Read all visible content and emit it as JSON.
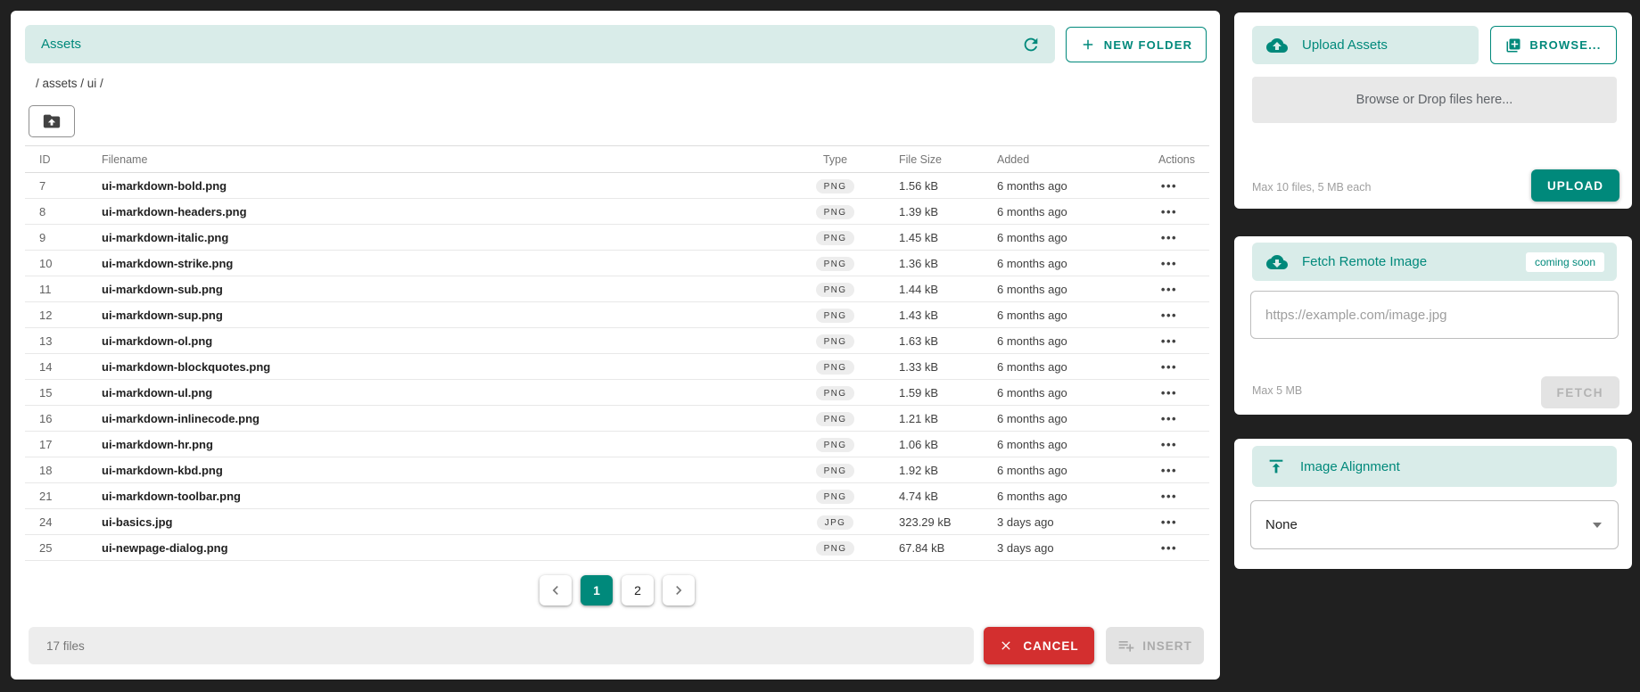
{
  "colors": {
    "teal": "#00897b",
    "teal_light": "#d9ece9",
    "red": "#d32f2f",
    "page_bg": "#202020"
  },
  "assets_dialog": {
    "title": "Assets",
    "new_folder_button": "NEW FOLDER",
    "breadcrumb": "/ assets / ui /",
    "table": {
      "headers": {
        "id": "ID",
        "filename": "Filename",
        "type": "Type",
        "size": "File Size",
        "added": "Added",
        "actions": "Actions"
      },
      "rows": [
        {
          "id": "7",
          "filename": "ui-markdown-bold.png",
          "type": "PNG",
          "size": "1.56 kB",
          "added": "6 months ago"
        },
        {
          "id": "8",
          "filename": "ui-markdown-headers.png",
          "type": "PNG",
          "size": "1.39 kB",
          "added": "6 months ago"
        },
        {
          "id": "9",
          "filename": "ui-markdown-italic.png",
          "type": "PNG",
          "size": "1.45 kB",
          "added": "6 months ago"
        },
        {
          "id": "10",
          "filename": "ui-markdown-strike.png",
          "type": "PNG",
          "size": "1.36 kB",
          "added": "6 months ago"
        },
        {
          "id": "11",
          "filename": "ui-markdown-sub.png",
          "type": "PNG",
          "size": "1.44 kB",
          "added": "6 months ago"
        },
        {
          "id": "12",
          "filename": "ui-markdown-sup.png",
          "type": "PNG",
          "size": "1.43 kB",
          "added": "6 months ago"
        },
        {
          "id": "13",
          "filename": "ui-markdown-ol.png",
          "type": "PNG",
          "size": "1.63 kB",
          "added": "6 months ago"
        },
        {
          "id": "14",
          "filename": "ui-markdown-blockquotes.png",
          "type": "PNG",
          "size": "1.33 kB",
          "added": "6 months ago"
        },
        {
          "id": "15",
          "filename": "ui-markdown-ul.png",
          "type": "PNG",
          "size": "1.59 kB",
          "added": "6 months ago"
        },
        {
          "id": "16",
          "filename": "ui-markdown-inlinecode.png",
          "type": "PNG",
          "size": "1.21 kB",
          "added": "6 months ago"
        },
        {
          "id": "17",
          "filename": "ui-markdown-hr.png",
          "type": "PNG",
          "size": "1.06 kB",
          "added": "6 months ago"
        },
        {
          "id": "18",
          "filename": "ui-markdown-kbd.png",
          "type": "PNG",
          "size": "1.92 kB",
          "added": "6 months ago"
        },
        {
          "id": "21",
          "filename": "ui-markdown-toolbar.png",
          "type": "PNG",
          "size": "4.74 kB",
          "added": "6 months ago"
        },
        {
          "id": "24",
          "filename": "ui-basics.jpg",
          "type": "JPG",
          "size": "323.29 kB",
          "added": "3 days ago"
        },
        {
          "id": "25",
          "filename": "ui-newpage-dialog.png",
          "type": "PNG",
          "size": "67.84 kB",
          "added": "3 days ago"
        }
      ],
      "row_actions_glyph": "•••"
    },
    "pagination": {
      "pages": [
        {
          "label": "1",
          "active": true
        },
        {
          "label": "2",
          "active": false
        }
      ]
    },
    "footer": {
      "file_count": "17 files",
      "cancel_button": "CANCEL",
      "insert_button": "INSERT"
    }
  },
  "upload_panel": {
    "title": "Upload Assets",
    "browse_button": "BROWSE...",
    "dropzone_text": "Browse or Drop files here...",
    "limit_text": "Max 10 files, 5 MB each",
    "upload_button": "UPLOAD"
  },
  "fetch_panel": {
    "title": "Fetch Remote Image",
    "badge": "coming soon",
    "url_placeholder": "https://example.com/image.jpg",
    "limit_text": "Max 5 MB",
    "fetch_button": "FETCH"
  },
  "alignment_panel": {
    "title": "Image Alignment",
    "selected_value": "None"
  }
}
